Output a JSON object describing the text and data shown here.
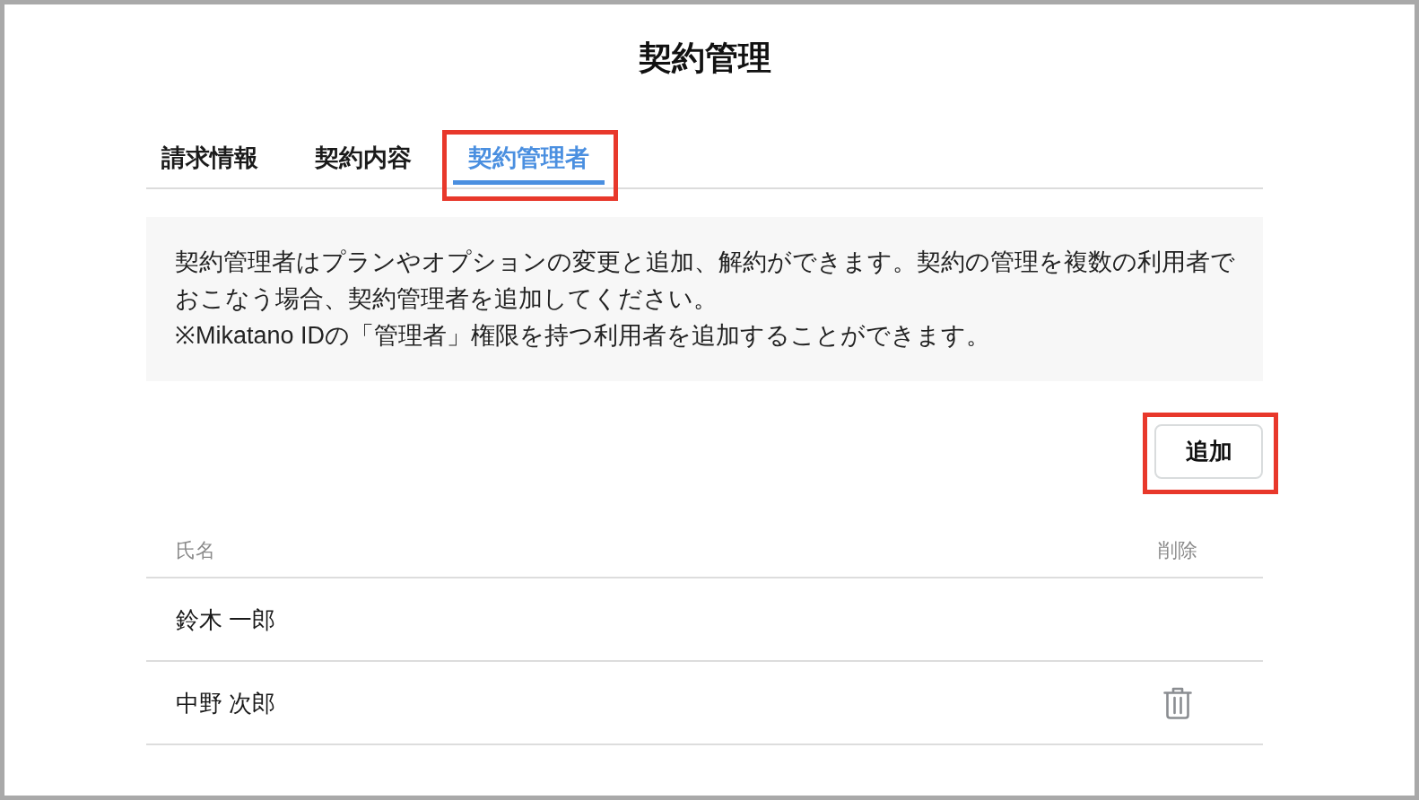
{
  "title": "契約管理",
  "tabs": [
    {
      "label": "請求情報",
      "selected": false,
      "highlighted": false
    },
    {
      "label": "契約内容",
      "selected": false,
      "highlighted": false
    },
    {
      "label": "契約管理者",
      "selected": true,
      "highlighted": true
    }
  ],
  "notice": {
    "paragraphs": [
      "契約管理者はプランやオプションの変更と追加、解約ができます。契約の管理を複数の利用者でおこなう場合、契約管理者を追加してください。",
      "※Mikatano IDの「管理者」権限を持つ利用者を追加することができます。"
    ]
  },
  "add_button": {
    "label": "追加",
    "highlighted": true
  },
  "table": {
    "columns": [
      "氏名",
      "削除"
    ],
    "rows": [
      {
        "name": "鈴木 一郎",
        "deletable": false
      },
      {
        "name": "中野 次郎",
        "deletable": true
      }
    ]
  }
}
